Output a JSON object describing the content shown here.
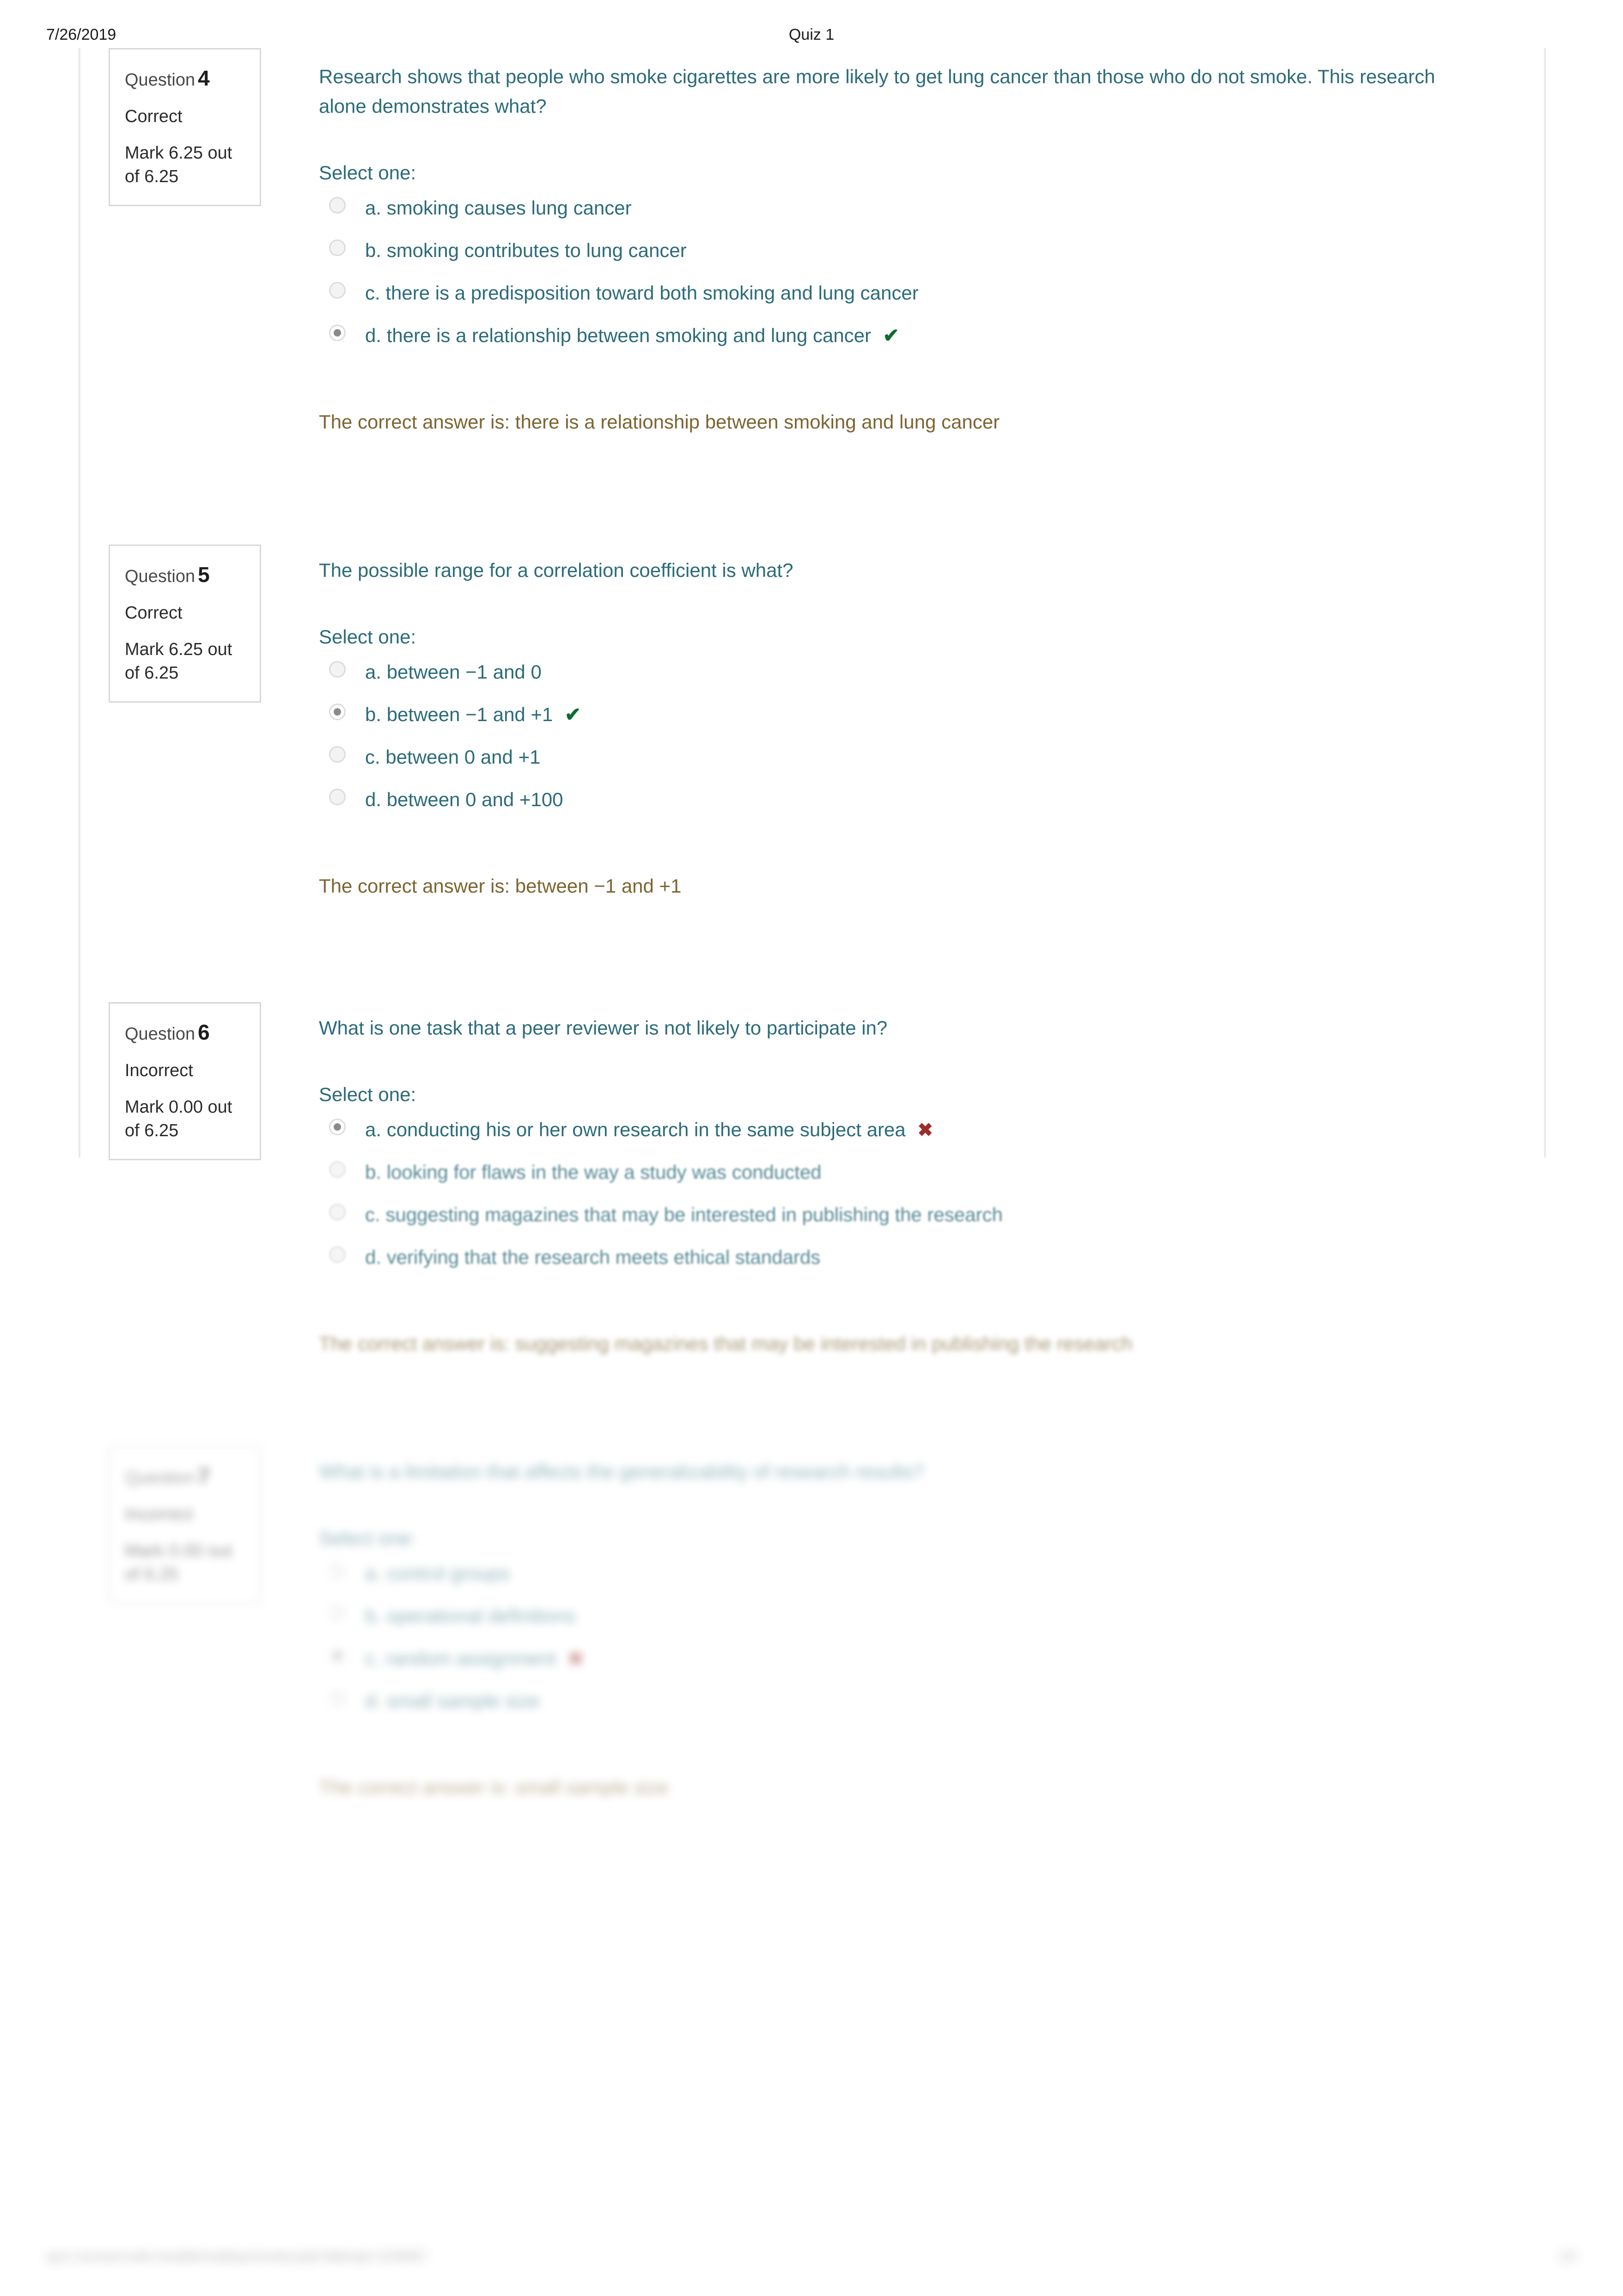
{
  "print_header": {
    "date": "7/26/2019",
    "title": "Quiz 1"
  },
  "print_footer": {
    "url": "quiz.coursera.web.moodle/mod/quiz/review.php?attempt=1234567",
    "page": "1/2"
  },
  "labels": {
    "question_word": "Question",
    "select_one": "Select one:"
  },
  "colors": {
    "question_text": "#2c6b7a",
    "feedback_text": "#7d6431",
    "correct_mark": "#0f6b2e",
    "incorrect_mark": "#9c2d2d",
    "box_border": "#d5d8dc",
    "frame_border": "#e8e9ea"
  },
  "questions": [
    {
      "number": "4",
      "state": "Correct",
      "grade": "Mark 6.25 out of 6.25",
      "text": "Research shows that people who smoke cigarettes are more likely to get lung cancer than those who do not smoke. This research alone demonstrates what?",
      "options": [
        {
          "label": "a. smoking causes lung cancer",
          "selected": false,
          "mark": ""
        },
        {
          "label": "b. smoking contributes to lung cancer",
          "selected": false,
          "mark": ""
        },
        {
          "label": "c. there is a predisposition toward both smoking and lung cancer",
          "selected": false,
          "mark": ""
        },
        {
          "label": "d. there is a relationship between smoking and lung cancer",
          "selected": true,
          "mark": "correct"
        }
      ],
      "feedback": "The correct answer is: there is a relationship between smoking and lung cancer"
    },
    {
      "number": "5",
      "state": "Correct",
      "grade": "Mark 6.25 out of 6.25",
      "text": "The possible range for a correlation coefficient is what?",
      "options": [
        {
          "label": "a. between −1 and 0",
          "selected": false,
          "mark": ""
        },
        {
          "label": "b. between −1 and +1",
          "selected": true,
          "mark": "correct"
        },
        {
          "label": "c. between 0 and +1",
          "selected": false,
          "mark": ""
        },
        {
          "label": "d. between 0 and +100",
          "selected": false,
          "mark": ""
        }
      ],
      "feedback": "The correct answer is: between −1 and +1"
    },
    {
      "number": "6",
      "state": "Incorrect",
      "grade": "Mark 0.00 out of 6.25",
      "text": "What is one task that a peer reviewer is not likely to participate in?",
      "options": [
        {
          "label": "a. conducting his or her own research in the same subject area",
          "selected": true,
          "mark": "incorrect"
        },
        {
          "label": "b. looking for flaws in the way a study was conducted",
          "selected": false,
          "mark": ""
        },
        {
          "label": "c. suggesting magazines that may be interested in publishing the research",
          "selected": false,
          "mark": ""
        },
        {
          "label": "d. verifying that the research meets ethical standards",
          "selected": false,
          "mark": ""
        }
      ],
      "feedback": "The correct answer is: suggesting magazines that may be interested in publishing the research"
    },
    {
      "number": "7",
      "state": "Incorrect",
      "grade": "Mark 0.00 out of 6.25",
      "text": "What is a limitation that affects the generalizability of research results?",
      "options": [
        {
          "label": "a. control groups",
          "selected": false,
          "mark": ""
        },
        {
          "label": "b. operational definitions",
          "selected": false,
          "mark": ""
        },
        {
          "label": "c. random assignment",
          "selected": true,
          "mark": "incorrect"
        },
        {
          "label": "d. small sample size",
          "selected": false,
          "mark": ""
        }
      ],
      "feedback": "The correct answer is: small sample size"
    }
  ],
  "marks": {
    "correct_glyph": "✔",
    "incorrect_glyph": "✖"
  }
}
